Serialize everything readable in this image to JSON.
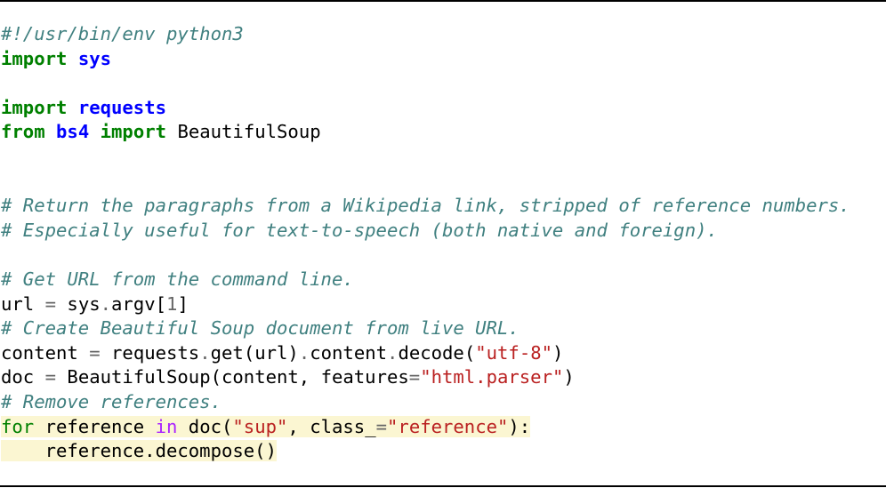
{
  "code": {
    "shebang": "#!/usr/bin/env python3",
    "kw_import": "import",
    "kw_from": "from",
    "kw_for": "for",
    "kw_in": "in",
    "mod_sys": "sys",
    "mod_requests": "requests",
    "mod_bs4": "bs4",
    "name_BeautifulSoup": "BeautifulSoup",
    "comment_return": "# Return the paragraphs from a Wikipedia link, stripped of reference numbers.",
    "comment_especially": "# Especially useful for text-to-speech (both native and foreign).",
    "comment_get_url": "# Get URL from the command line.",
    "comment_create": "# Create Beautiful Soup document from live URL.",
    "comment_remove": "# Remove references.",
    "url_var": "url",
    "eq": "=",
    "sys": "sys",
    "dot": ".",
    "argv": "argv[",
    "argv_index": "1",
    "close_bracket": "]",
    "content_var": "content ",
    "requests": "requests",
    "get_call": "get(url)",
    "content_attr": "content",
    "decode_open": "decode(",
    "str_utf8": "\"utf-8\"",
    "close_paren": ")",
    "doc_var": "doc ",
    "bs_call_open": " BeautifulSoup(content, features",
    "str_html_parser": "\"html.parser\"",
    "for_target": " reference ",
    "doc_call_open": " doc(",
    "str_sup": "\"sup\"",
    "class_kw": ", class_",
    "str_reference": "\"reference\"",
    "for_end": "):",
    "decompose_line": "    reference.decompose()"
  },
  "colors": {
    "keyword": "#008000",
    "module": "#0000ff",
    "comment": "#408080",
    "string": "#ba2121",
    "operator": "#666666",
    "in_keyword": "#aa22ff",
    "highlight": "#fbf6d2"
  }
}
